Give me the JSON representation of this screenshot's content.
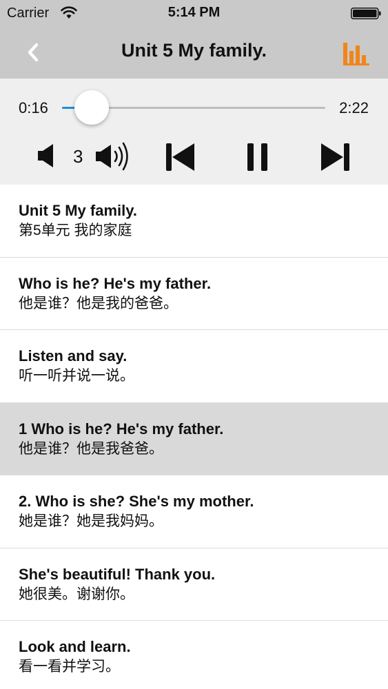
{
  "status_bar": {
    "carrier": "Carrier",
    "time": "5:14 PM"
  },
  "nav": {
    "title": "Unit 5  My family.",
    "back_icon": "chevron-left-icon",
    "chart_icon": "bar-chart-icon",
    "accent_color": "#f0861a"
  },
  "player": {
    "current_time": "0:16",
    "total_time": "2:22",
    "progress": 0.113,
    "volume_level": "3",
    "progress_color": "#1e8fd6"
  },
  "sentences": [
    {
      "en": "Unit 5 My family.",
      "zh": "第5单元 我的家庭",
      "selected": false
    },
    {
      "en": "Who is he? He's my father.",
      "zh": "他是谁？他是我的爸爸。",
      "selected": false
    },
    {
      "en": "Listen and say.",
      "zh": "听一听并说一说。",
      "selected": false
    },
    {
      "en": "1 Who is he? He's my father.",
      "zh": "他是谁？他是我爸爸。",
      "selected": true
    },
    {
      "en": "2. Who is she? She's my mother.",
      "zh": "她是谁？她是我妈妈。",
      "selected": false
    },
    {
      "en": "She's beautiful! Thank you.",
      "zh": "她很美。谢谢你。",
      "selected": false
    },
    {
      "en": "Look and learn.",
      "zh": "看一看并学习。",
      "selected": false
    }
  ]
}
